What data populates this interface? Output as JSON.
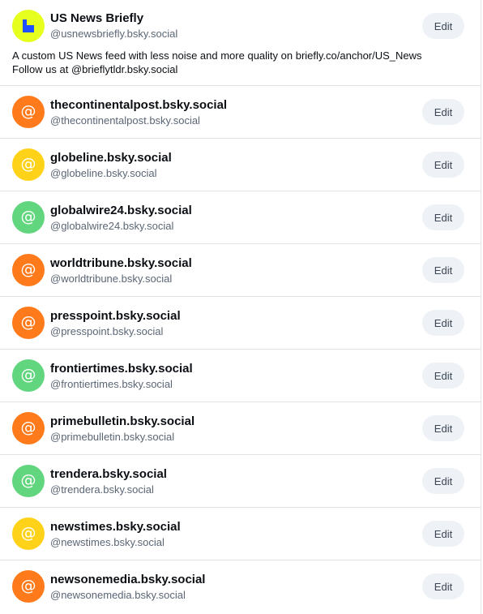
{
  "feed": {
    "name": "US News Briefly",
    "handle": "@usnewsbriefly.bsky.social",
    "description_line1": "A custom US News feed with less noise and more quality on briefly.co/anchor/US_News",
    "description_line2": "Follow us at @brieflytldr.bsky.social",
    "edit_label": "Edit",
    "avatar_color": "#e6ff1e",
    "avatar_icon": "briefly-logo-icon"
  },
  "accounts": [
    {
      "name": "thecontinentalpost.bsky.social",
      "handle": "@thecontinentalpost.bsky.social",
      "edit_label": "Edit",
      "avatar_color": "#ff7a1a",
      "avatar_icon": "at-icon"
    },
    {
      "name": "globeline.bsky.social",
      "handle": "@globeline.bsky.social",
      "edit_label": "Edit",
      "avatar_color": "#ffd21a",
      "avatar_icon": "at-icon"
    },
    {
      "name": "globalwire24.bsky.social",
      "handle": "@globalwire24.bsky.social",
      "edit_label": "Edit",
      "avatar_color": "#62d67e",
      "avatar_icon": "at-icon"
    },
    {
      "name": "worldtribune.bsky.social",
      "handle": "@worldtribune.bsky.social",
      "edit_label": "Edit",
      "avatar_color": "#ff7a1a",
      "avatar_icon": "at-icon"
    },
    {
      "name": "presspoint.bsky.social",
      "handle": "@presspoint.bsky.social",
      "edit_label": "Edit",
      "avatar_color": "#ff7a1a",
      "avatar_icon": "at-icon"
    },
    {
      "name": "frontiertimes.bsky.social",
      "handle": "@frontiertimes.bsky.social",
      "edit_label": "Edit",
      "avatar_color": "#62d67e",
      "avatar_icon": "at-icon"
    },
    {
      "name": "primebulletin.bsky.social",
      "handle": "@primebulletin.bsky.social",
      "edit_label": "Edit",
      "avatar_color": "#ff7a1a",
      "avatar_icon": "at-icon"
    },
    {
      "name": "trendera.bsky.social",
      "handle": "@trendera.bsky.social",
      "edit_label": "Edit",
      "avatar_color": "#62d67e",
      "avatar_icon": "at-icon"
    },
    {
      "name": "newstimes.bsky.social",
      "handle": "@newstimes.bsky.social",
      "edit_label": "Edit",
      "avatar_color": "#ffd21a",
      "avatar_icon": "at-icon"
    },
    {
      "name": "newsonemedia.bsky.social",
      "handle": "@newsonemedia.bsky.social",
      "edit_label": "Edit",
      "avatar_color": "#ff7a1a",
      "avatar_icon": "at-icon"
    }
  ]
}
